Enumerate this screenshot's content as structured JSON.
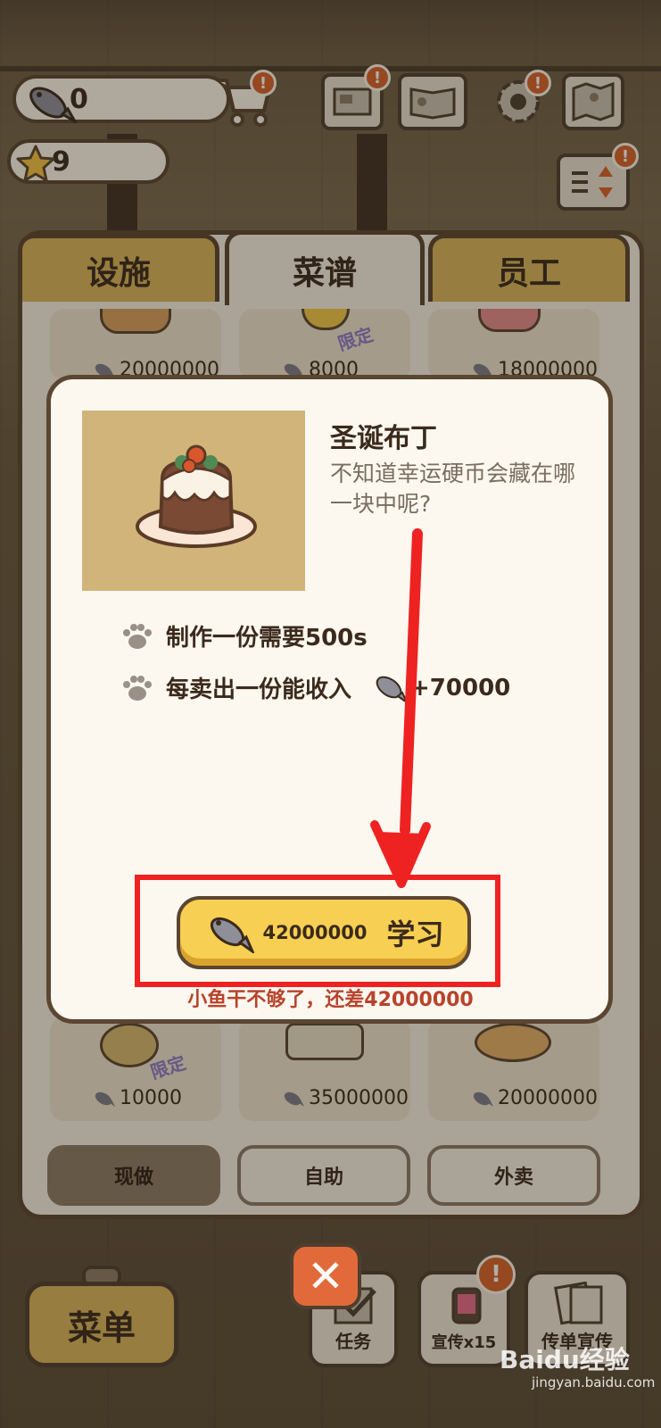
{
  "hud": {
    "fish_count": "0",
    "star_count": "9"
  },
  "tabs": [
    {
      "label": "设施",
      "active": false
    },
    {
      "label": "菜谱",
      "active": true
    },
    {
      "label": "员工",
      "active": false
    }
  ],
  "recipe_cards_top": [
    {
      "price": "20000000",
      "limited": false
    },
    {
      "price": "8000",
      "limited": true,
      "limited_label": "限定"
    },
    {
      "price": "18000000",
      "limited": false
    }
  ],
  "recipe_cards_bottom": [
    {
      "price": "10000",
      "limited": true,
      "limited_label": "限定"
    },
    {
      "price": "35000000",
      "limited": false
    },
    {
      "price": "20000000",
      "limited": false
    }
  ],
  "modes": [
    {
      "label": "现做",
      "active": true
    },
    {
      "label": "自助",
      "active": false
    },
    {
      "label": "外卖",
      "active": false
    }
  ],
  "modal": {
    "dish_name": "圣诞布丁",
    "dish_desc": "不知道幸运硬币会藏在哪一块中呢?",
    "make_time": "制作一份需要500s",
    "income_label": "每卖出一份能收入",
    "income_value": "+70000",
    "learn_cost": "42000000",
    "learn_label": "学习",
    "warning": "小鱼干不够了，还差42000000"
  },
  "bottom": {
    "menu_label": "菜单",
    "task_label": "任务",
    "promote_label": "宣传x15",
    "flyer_label": "传单宣传",
    "close_symbol": "✕"
  },
  "watermark": {
    "main": "Baidu经验",
    "sub": "jingyan.baidu.com"
  },
  "colors": {
    "accent_yellow": "#f7cf52",
    "frame_brown": "#5b4631",
    "badge_orange": "#d8632a",
    "annotation_red": "#ef2222",
    "warning_red": "#b8432c"
  }
}
